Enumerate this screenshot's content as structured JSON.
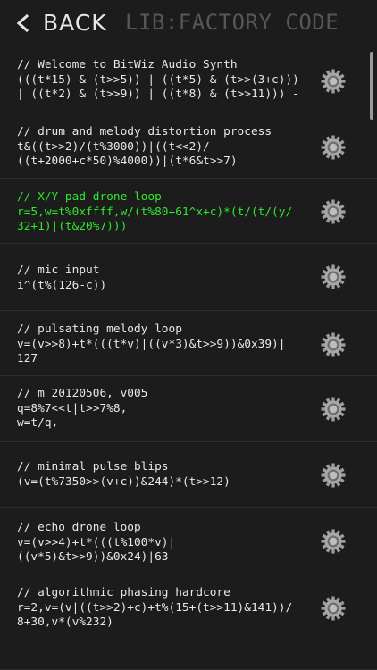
{
  "header": {
    "back_label": "BACK",
    "title": "LIB:FACTORY CODE"
  },
  "colors": {
    "background": "#1c1c1c",
    "text": "#e8e8e8",
    "highlight": "#2ee82e",
    "title_dim": "#575757"
  },
  "items": [
    {
      "line1": "// Welcome to BitWiz Audio Synth",
      "line2": "(((t*15) & (t>>5)) | ((t*5) & (t>>(3+c)))",
      "line3": "| ((t*2) & (t>>9)) | ((t*8) & (t>>11))) -",
      "selected": false
    },
    {
      "line1": "// drum and melody distortion process",
      "line2": "t&((t>>2)/(t%3000))|((t<<2)/",
      "line3": "((t+2000+c*50)%4000))|(t*6&t>>7)",
      "selected": false
    },
    {
      "line1": "// X/Y-pad drone loop",
      "line2": "r=5,w=t%0xffff,w/(t%80+61^x+c)*(t/(t/(y/",
      "line3": "32+1)|(t&20%7)))",
      "selected": true
    },
    {
      "line1": "// mic input",
      "line2": "i^(t%(126-c))",
      "line3": "",
      "selected": false
    },
    {
      "line1": "// pulsating melody loop",
      "line2": "v=(v>>8)+t*(((t*v)|((v*3)&t>>9))&0x39)|",
      "line3": "127",
      "selected": false
    },
    {
      "line1": "// m 20120506, v005",
      "line2": "q=8%7<<t|t>>7%8,",
      "line3": "w=t/q,",
      "selected": false
    },
    {
      "line1": "// minimal pulse blips",
      "line2": "(v=(t%7350>>(v+c))&244)*(t>>12)",
      "line3": "",
      "selected": false
    },
    {
      "line1": "// echo drone loop",
      "line2": "v=(v>>4)+t*(((t%100*v)|",
      "line3": "((v*5)&t>>9))&0x24)|63",
      "selected": false
    },
    {
      "line1": "// algorithmic phasing hardcore",
      "line2": "r=2,v=(v|((t>>2)+c)+t%(15+(t>>11)&141))/",
      "line3": "8+30,v*(v%232)",
      "selected": false
    }
  ]
}
